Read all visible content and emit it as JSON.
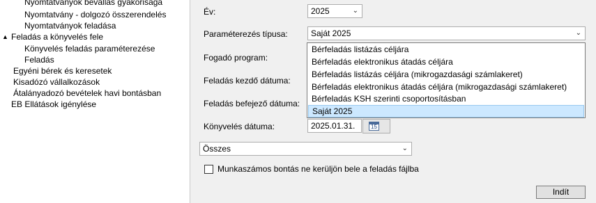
{
  "tree": {
    "items": [
      {
        "label": "Nyomtatványok bevallás gyakorisága"
      },
      {
        "label": "Nyomtatvány - dolgozó összerendelés"
      },
      {
        "label": "Nyomtatványok feladása"
      },
      {
        "label": "Feladás a könyvelés fele"
      },
      {
        "label": "Könyvelés feladás paraméterezése"
      },
      {
        "label": "Feladás"
      },
      {
        "label": "Egyéni bérek és keresetek"
      },
      {
        "label": "Kisadózó vállalkozások"
      },
      {
        "label": "Átalányadozó bevételek havi bontásban"
      },
      {
        "label": "EB Ellátások igénylése"
      }
    ],
    "caret": "▲"
  },
  "form": {
    "year_label": "Év:",
    "year_value": "2025",
    "param_type_label": "Paraméterezés típusa:",
    "param_type_value": "Saját 2025",
    "receiver_label": "Fogadó program:",
    "start_date_label": "Feladás kezdő dátuma:",
    "end_date_label": "Feladás befejező dátuma:",
    "booking_date_label": "Könyvelés dátuma:",
    "booking_date_value": "2025.01.31.",
    "calendar_day": "15",
    "filter_value": "Összes",
    "checkbox_label": "Munkaszámos bontás ne kerüljön bele a feladás fájlba",
    "send_button": "Indít",
    "chevron": "⌄"
  },
  "dropdown": {
    "options": [
      "Bérfeladás listázás céljára",
      "Bérfeladás elektronikus átadás céljára",
      "Bérfeladás listázás céljára (mikrogazdasági számlakeret)",
      "Bérfeladás elektronikus átadás céljára (mikrogazdasági számlakeret)",
      "Bérfeladás KSH szerinti csoportosításban",
      "Saját 2025"
    ],
    "selected_index": 5
  }
}
